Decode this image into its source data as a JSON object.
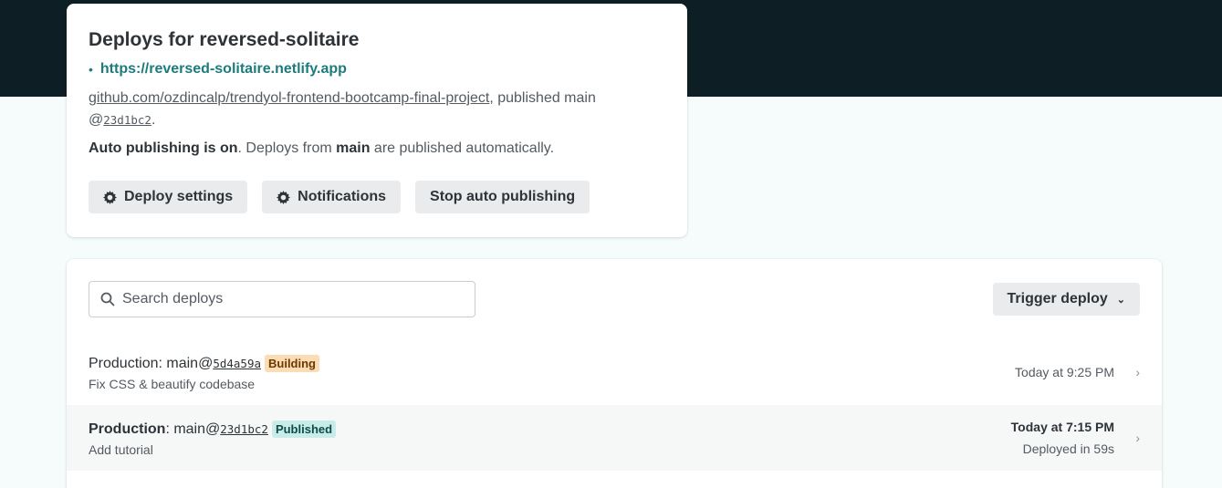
{
  "overview": {
    "title": "Deploys for reversed-solitaire",
    "site_url": "https://reversed-solitaire.netlify.app",
    "repo_link": "github.com/ozdincalp/trendyol-frontend-bootcamp-final-project",
    "repo_suffix": ", published main",
    "commit_prefix": "@",
    "commit": "23d1bc2",
    "commit_suffix": ".",
    "auto_bold": "Auto publishing is on",
    "auto_mid": ". Deploys from ",
    "auto_branch": "main",
    "auto_tail": " are published automatically.",
    "buttons": {
      "deploy_settings": "Deploy settings",
      "notifications": "Notifications",
      "stop_auto": "Stop auto publishing"
    }
  },
  "deploys": {
    "search_placeholder": "Search deploys",
    "trigger_label": "Trigger deploy",
    "rows": [
      {
        "context": "Production",
        "branch_prefix": ": main@",
        "commit": "5d4a59a",
        "status": "Building",
        "message": "Fix CSS & beautify codebase",
        "time": "Today at 9:25 PM",
        "duration": ""
      },
      {
        "context": "Production",
        "branch_prefix": ": main@",
        "commit": "23d1bc2",
        "status": "Published",
        "message": "Add tutorial",
        "time": "Today at 7:15 PM",
        "duration": "Deployed in 59s"
      }
    ]
  },
  "colors": {
    "header_bg": "#0e1e25",
    "link_teal": "#1e7b7c",
    "building_badge": "#fbdcb5",
    "published_badge": "#c8ece8"
  },
  "icons": [
    "gear-icon",
    "search-icon",
    "chevron-down-icon",
    "chevron-right-icon"
  ]
}
